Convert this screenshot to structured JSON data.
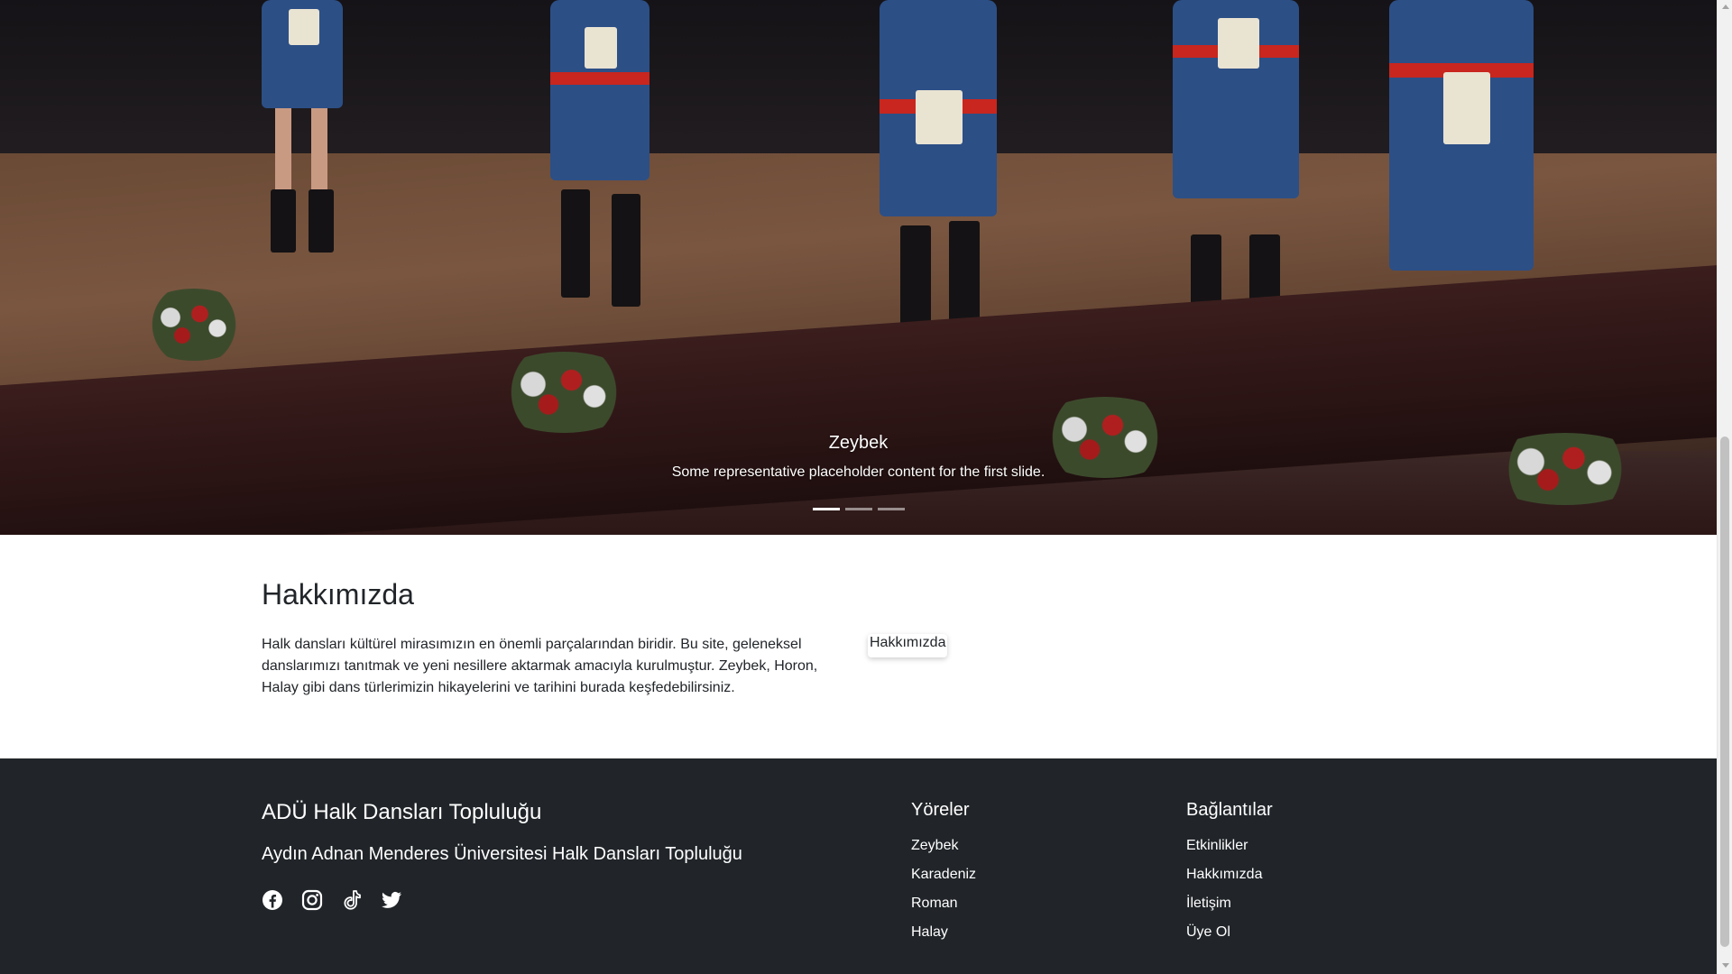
{
  "carousel": {
    "slide_title": "Zeybek",
    "slide_text": "Some representative placeholder content for the first slide.",
    "indicator_count": 3,
    "active_index": 0
  },
  "about": {
    "heading": "Hakkımızda",
    "paragraph": "Halk dansları kültürel mirasımızın en önemli parçalarından biridir. Bu site, geleneksel danslarımızı tanıtmak ve yeni nesillere aktarmak amacıyla kurulmuştur. Zeybek, Horon, Halay gibi dans türlerimizin hikayelerini ve tarihini burada keşfedebilirsiniz.",
    "image_alt": "Hakkımızda"
  },
  "footer": {
    "brand": "ADÜ Halk Dansları Topluluğu",
    "tagline": "Aydın Adnan Menderes Üniversitesi Halk Dansları Topluluğu",
    "social": [
      "facebook-icon",
      "instagram-icon",
      "tiktok-icon",
      "twitter-icon"
    ],
    "regions": {
      "heading": "Yöreler",
      "links": [
        "Zeybek",
        "Karadeniz",
        "Roman",
        "Halay"
      ]
    },
    "links": {
      "heading": "Bağlantılar",
      "items": [
        "Etkinlikler",
        "Hakkımızda",
        "İletişim",
        "Üye Ol"
      ]
    }
  },
  "colors": {
    "footer_bg": "#212529",
    "text": "#212529",
    "white": "#ffffff"
  }
}
